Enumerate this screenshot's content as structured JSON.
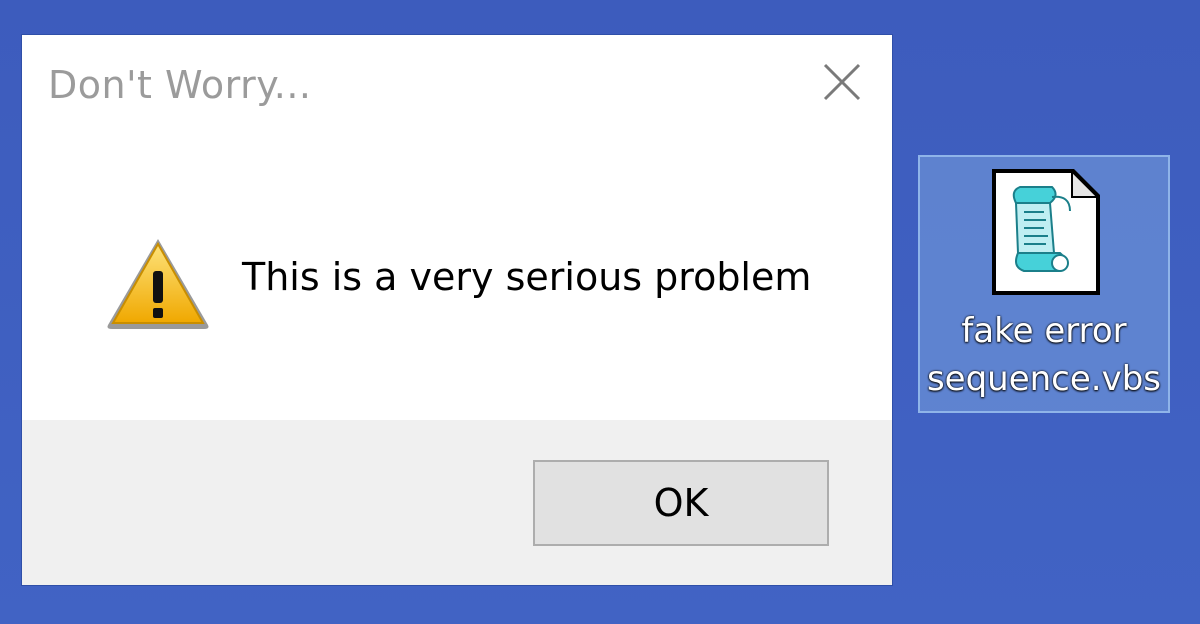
{
  "dialog": {
    "title": "Don't Worry...",
    "message": "This is a very serious problem",
    "ok_label": "OK",
    "icon": "warning-icon"
  },
  "desktop": {
    "file_icon": {
      "name_line1": "fake error",
      "name_line2": "sequence.vbs",
      "icon": "vbs-script-file-icon"
    }
  },
  "colors": {
    "desktop": "#3f5fbf",
    "title_text": "#9b9b9b",
    "footer": "#f0f0f0",
    "warning": "#f7c325"
  }
}
